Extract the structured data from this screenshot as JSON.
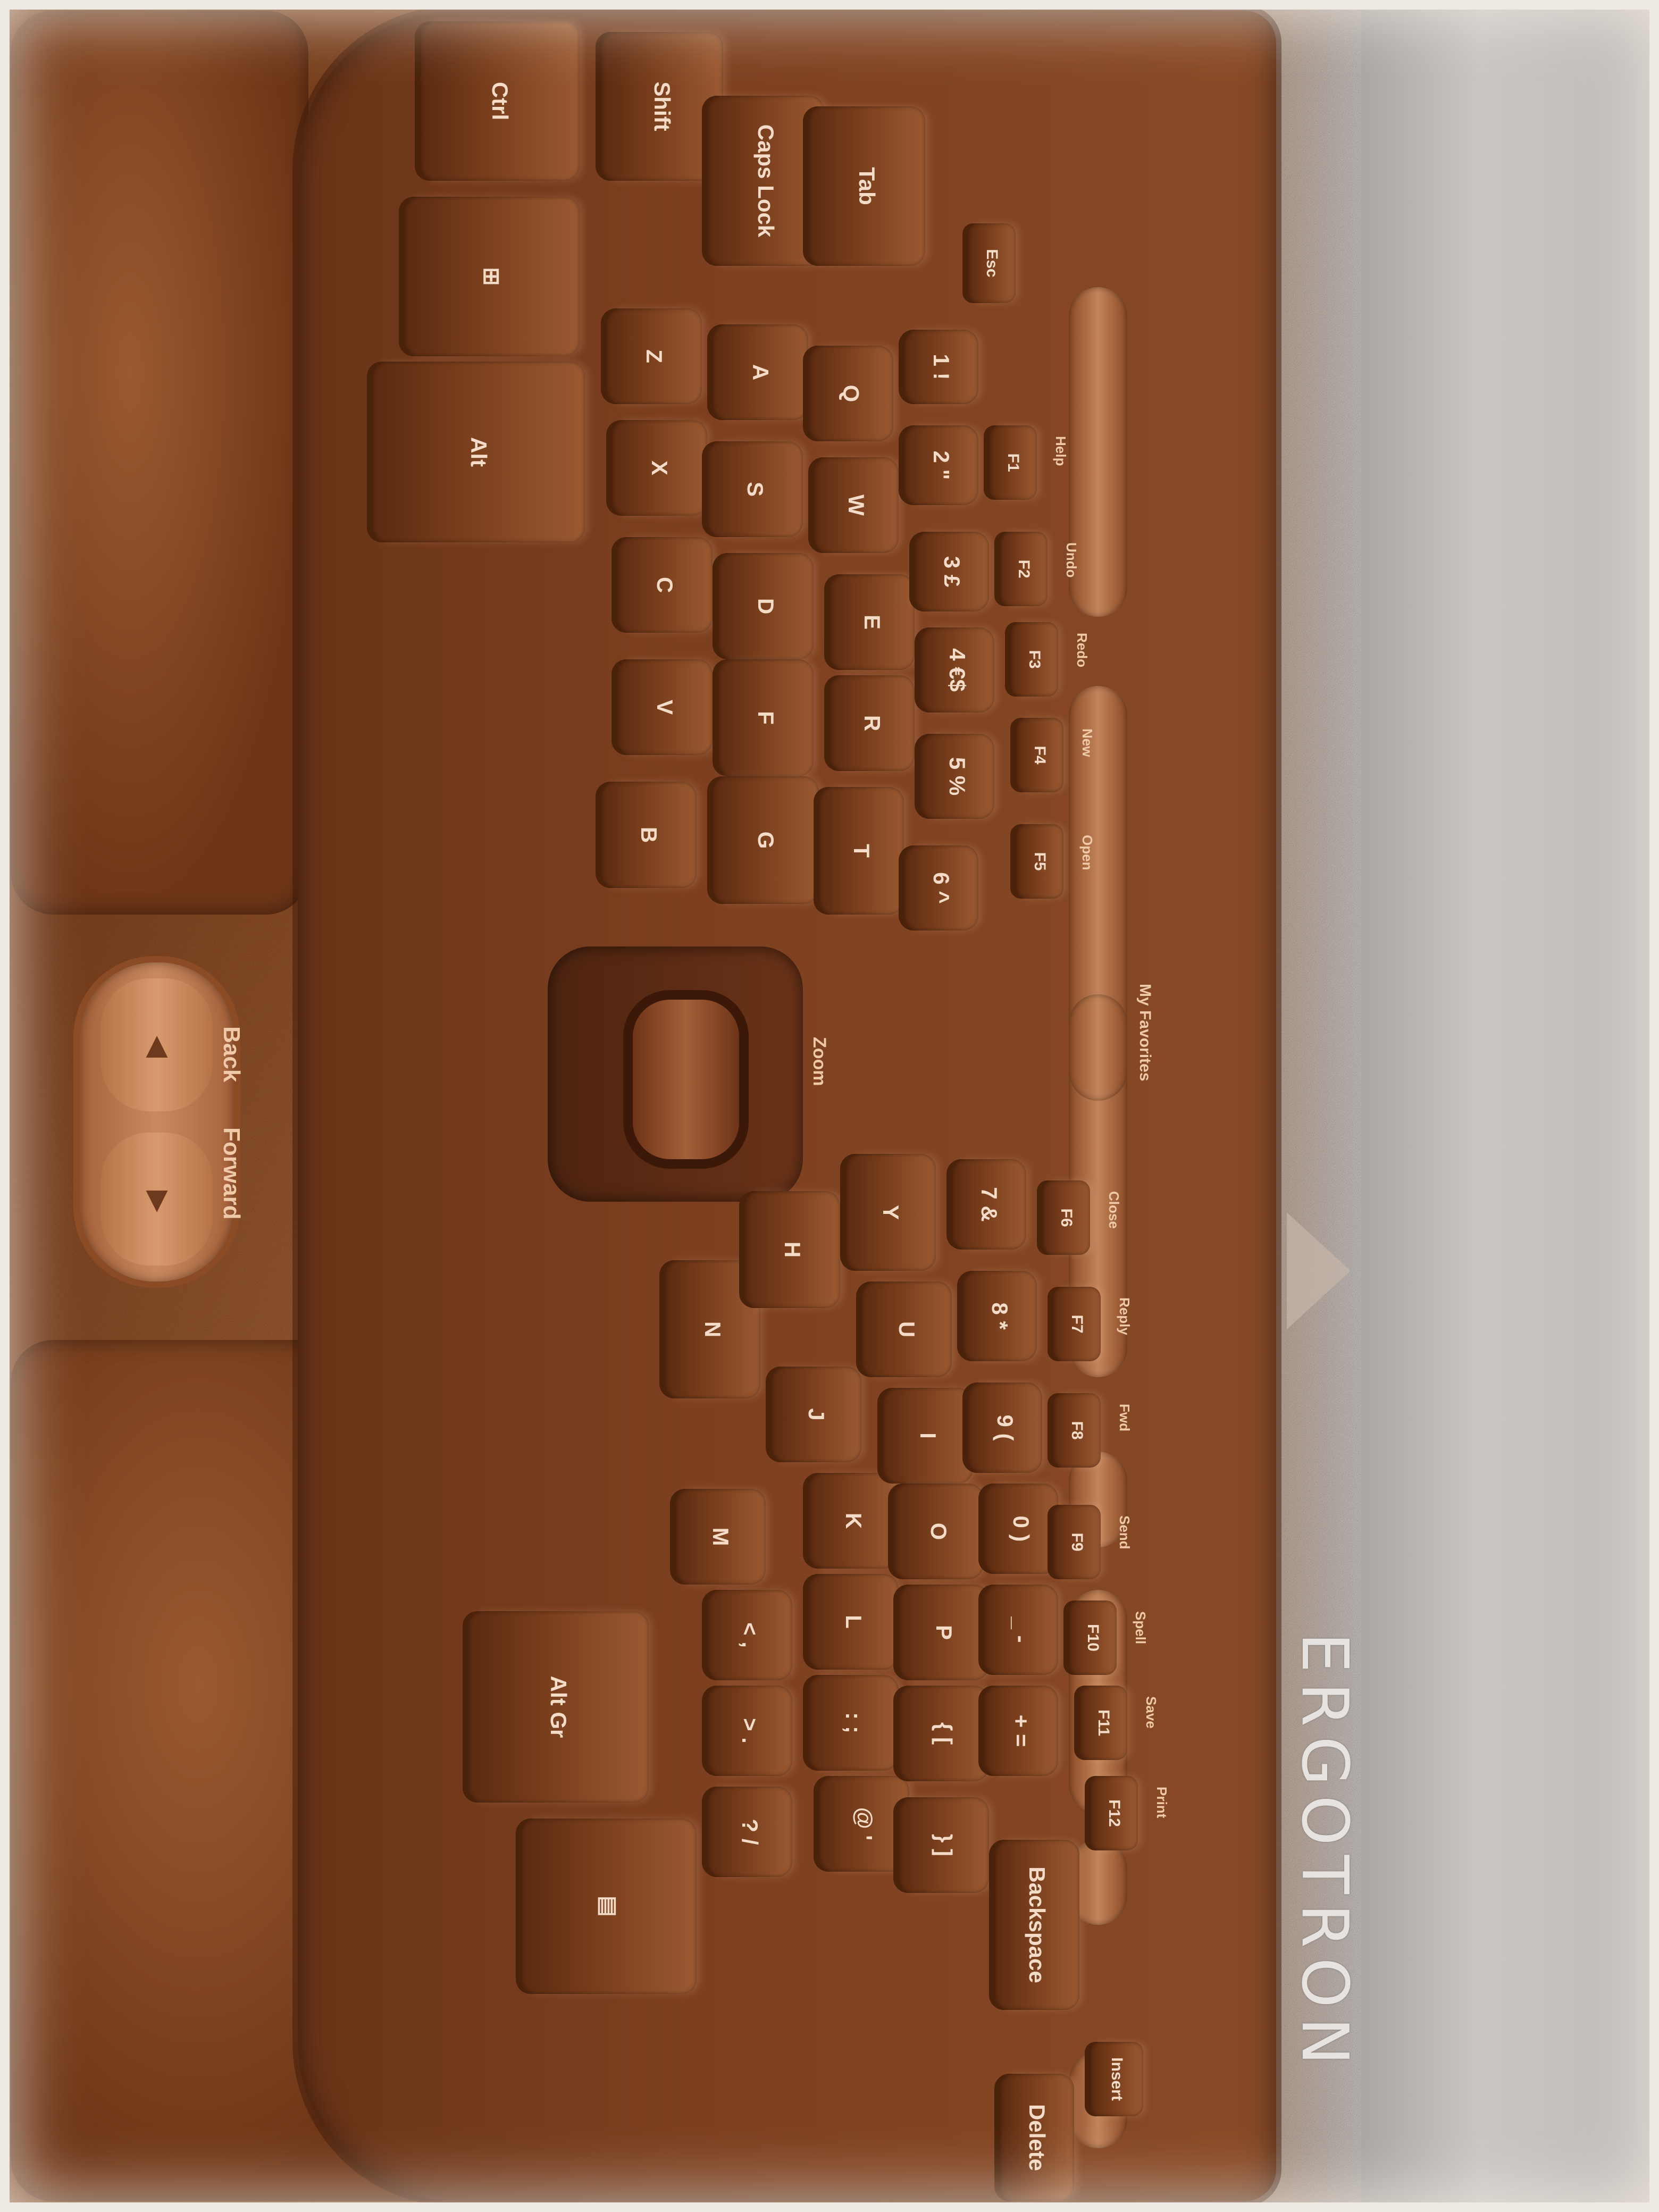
{
  "image": {
    "subject": "ergonomic keyboard on desk",
    "tint_color": "#8a4a22"
  },
  "branding": {
    "monitor_brand": "ERGOTRON"
  },
  "nav_buttons": {
    "back_label": "Back",
    "forward_label": "Forward"
  },
  "zoom": {
    "label": "Zoom"
  },
  "favorites": {
    "label": "My Favorites"
  },
  "keys_left": [
    {
      "id": "ctrl",
      "label": "Ctrl"
    },
    {
      "id": "win",
      "label": "⊞"
    },
    {
      "id": "alt",
      "label": "Alt"
    },
    {
      "id": "shift",
      "label": "Shift"
    },
    {
      "id": "caps",
      "label": "Caps Lock"
    },
    {
      "id": "tab",
      "label": "Tab"
    },
    {
      "id": "esc",
      "label": "Esc"
    },
    {
      "id": "z",
      "label": "Z"
    },
    {
      "id": "x",
      "label": "X"
    },
    {
      "id": "c",
      "label": "C"
    },
    {
      "id": "v",
      "label": "V"
    },
    {
      "id": "b",
      "label": "B"
    },
    {
      "id": "a",
      "label": "A"
    },
    {
      "id": "s",
      "label": "S"
    },
    {
      "id": "d",
      "label": "D"
    },
    {
      "id": "f",
      "label": "F"
    },
    {
      "id": "g",
      "label": "G"
    },
    {
      "id": "q",
      "label": "Q"
    },
    {
      "id": "w",
      "label": "W"
    },
    {
      "id": "e",
      "label": "E"
    },
    {
      "id": "r",
      "label": "R"
    },
    {
      "id": "t",
      "label": "T"
    },
    {
      "id": "n1",
      "label": "1 !"
    },
    {
      "id": "n2",
      "label": "2 \""
    },
    {
      "id": "n3",
      "label": "3 £"
    },
    {
      "id": "n4",
      "label": "4 €$"
    },
    {
      "id": "n5",
      "label": "5 %"
    },
    {
      "id": "n6",
      "label": "6 ^"
    },
    {
      "id": "f1",
      "label": "F1"
    },
    {
      "id": "f2",
      "label": "F2"
    },
    {
      "id": "f3",
      "label": "F3"
    },
    {
      "id": "f4",
      "label": "F4"
    },
    {
      "id": "f5",
      "label": "F5"
    }
  ],
  "fn_captions_left": [
    "Help",
    "Undo",
    "Redo",
    "New",
    "Open"
  ],
  "keys_right": [
    {
      "id": "altgr",
      "label": "Alt Gr"
    },
    {
      "id": "menu",
      "label": "▤"
    },
    {
      "id": "n",
      "label": "N"
    },
    {
      "id": "m",
      "label": "M"
    },
    {
      "id": "comma",
      "label": "< ,"
    },
    {
      "id": "period",
      "label": "> ."
    },
    {
      "id": "slash",
      "label": "? /"
    },
    {
      "id": "h",
      "label": "H"
    },
    {
      "id": "j",
      "label": "J"
    },
    {
      "id": "k",
      "label": "K"
    },
    {
      "id": "l",
      "label": "L"
    },
    {
      "id": "semicolon",
      "label": ": ;"
    },
    {
      "id": "quote",
      "label": "@ '"
    },
    {
      "id": "y",
      "label": "Y"
    },
    {
      "id": "u",
      "label": "U"
    },
    {
      "id": "i",
      "label": "I"
    },
    {
      "id": "o",
      "label": "O"
    },
    {
      "id": "p",
      "label": "P"
    },
    {
      "id": "bracket_open",
      "label": "{ ["
    },
    {
      "id": "bracket_close",
      "label": "} ]"
    },
    {
      "id": "n7",
      "label": "7 &"
    },
    {
      "id": "n8",
      "label": "8 *"
    },
    {
      "id": "n9",
      "label": "9 ("
    },
    {
      "id": "n0",
      "label": "0 )"
    },
    {
      "id": "minus",
      "label": "_ -"
    },
    {
      "id": "equals",
      "label": "+ ="
    },
    {
      "id": "f6",
      "label": "F6"
    },
    {
      "id": "f7",
      "label": "F7"
    },
    {
      "id": "f8",
      "label": "F8"
    },
    {
      "id": "f9",
      "label": "F9"
    },
    {
      "id": "f10",
      "label": "F10"
    },
    {
      "id": "f11",
      "label": "F11"
    },
    {
      "id": "f12",
      "label": "F12"
    },
    {
      "id": "backspace",
      "label": "Backspace"
    },
    {
      "id": "insert",
      "label": "Insert"
    },
    {
      "id": "delete",
      "label": "Delete"
    }
  ],
  "fn_captions_right": [
    "Close",
    "Reply",
    "Fwd",
    "Send",
    "Spell",
    "Save",
    "Print"
  ]
}
